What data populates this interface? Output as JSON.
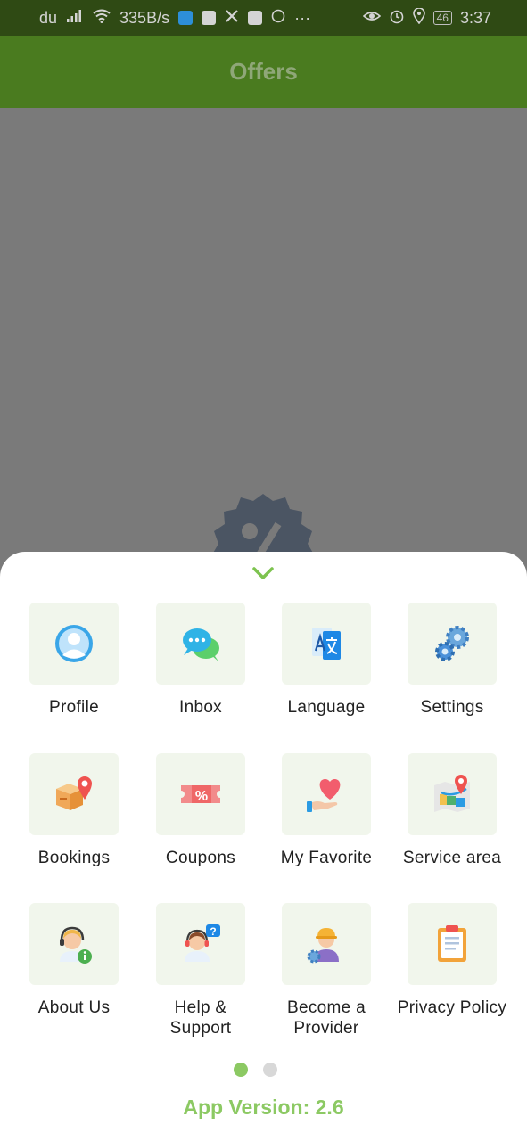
{
  "status_bar": {
    "carrier": "du",
    "speed": "335B/s",
    "battery": "46",
    "time": "3:37",
    "more": "···"
  },
  "app_bar": {
    "title": "Offers"
  },
  "menu": {
    "items": [
      {
        "label": "Profile",
        "icon": "profile-icon"
      },
      {
        "label": "Inbox",
        "icon": "inbox-icon"
      },
      {
        "label": "Language",
        "icon": "language-icon"
      },
      {
        "label": "Settings",
        "icon": "settings-icon"
      },
      {
        "label": "Bookings",
        "icon": "bookings-icon"
      },
      {
        "label": "Coupons",
        "icon": "coupons-icon"
      },
      {
        "label": "My Favorite",
        "icon": "favorite-icon"
      },
      {
        "label": "Service area",
        "icon": "service-area-icon"
      },
      {
        "label": "About Us",
        "icon": "about-us-icon"
      },
      {
        "label": "Help &\nSupport",
        "icon": "help-support-icon"
      },
      {
        "label": "Become a\nProvider",
        "icon": "become-provider-icon"
      },
      {
        "label": "Privacy Policy",
        "icon": "privacy-policy-icon"
      }
    ]
  },
  "pagination": {
    "current": 1,
    "total": 2
  },
  "footer": {
    "version": "App Version: 2.6"
  },
  "colors": {
    "status_bar_bg": "#2f4a14",
    "app_bar_bg": "#4a7b1f",
    "accent": "#8cc963",
    "tile_bg": "#f1f6ec"
  }
}
